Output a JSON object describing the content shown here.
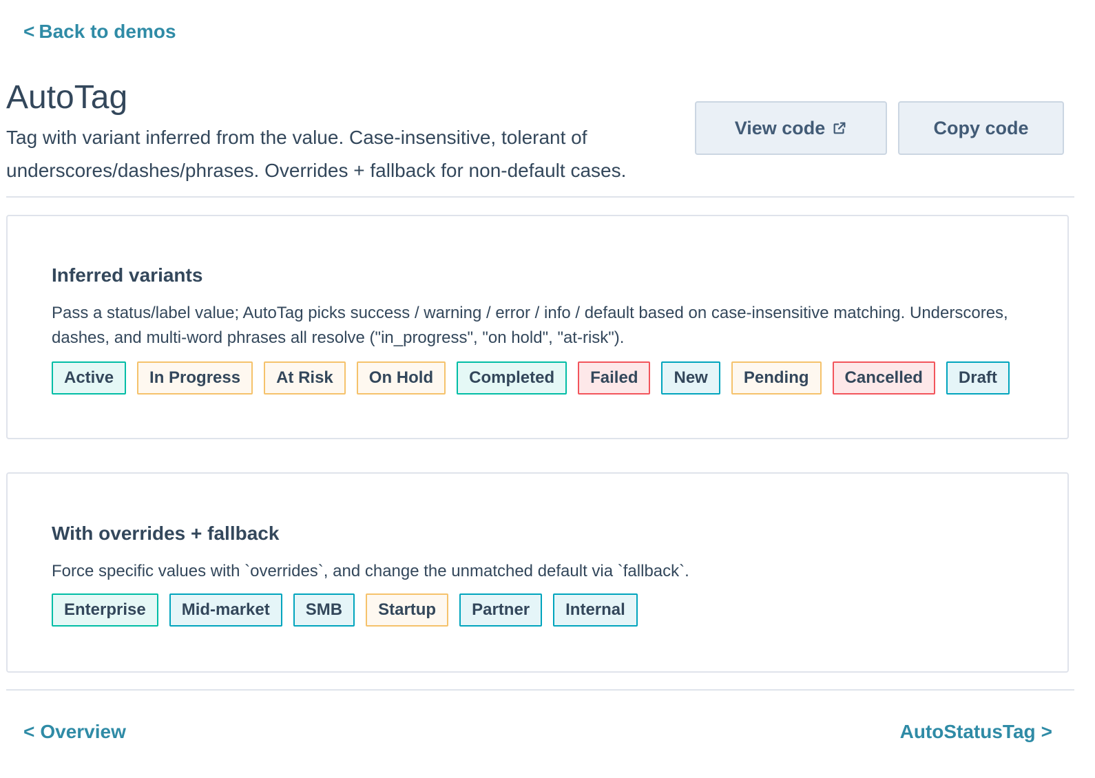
{
  "back": {
    "label": "Back to demos",
    "chevron": "<"
  },
  "header": {
    "title": "AutoTag",
    "description": "Tag with variant inferred from the value. Case-insensitive, tolerant of underscores/dashes/phrases. Overrides + fallback for non-default cases."
  },
  "buttons": {
    "view_code": "View code",
    "view_code_icon": "external-link-icon",
    "copy_code": "Copy code"
  },
  "sections": [
    {
      "title": "Inferred variants",
      "description": "Pass a status/label value; AutoTag picks success / warning / error / info / default based on case-insensitive matching. Underscores, dashes, and multi-word phrases all resolve (\"in_progress\", \"on hold\", \"at-risk\").",
      "tags": [
        {
          "label": "Active",
          "variant": "success"
        },
        {
          "label": "In Progress",
          "variant": "warning"
        },
        {
          "label": "At Risk",
          "variant": "warning"
        },
        {
          "label": "On Hold",
          "variant": "warning"
        },
        {
          "label": "Completed",
          "variant": "success"
        },
        {
          "label": "Failed",
          "variant": "error"
        },
        {
          "label": "New",
          "variant": "info"
        },
        {
          "label": "Pending",
          "variant": "warning"
        },
        {
          "label": "Cancelled",
          "variant": "error"
        },
        {
          "label": "Draft",
          "variant": "info"
        }
      ]
    },
    {
      "title": "With overrides + fallback",
      "description": "Force specific values with `overrides`, and change the unmatched default via `fallback`.",
      "tags": [
        {
          "label": "Enterprise",
          "variant": "success"
        },
        {
          "label": "Mid-market",
          "variant": "info"
        },
        {
          "label": "SMB",
          "variant": "info"
        },
        {
          "label": "Startup",
          "variant": "warning"
        },
        {
          "label": "Partner",
          "variant": "info"
        },
        {
          "label": "Internal",
          "variant": "info"
        }
      ]
    }
  ],
  "footer_nav": {
    "prev": "Overview",
    "prev_chevron": "<",
    "next": "AutoStatusTag",
    "next_chevron": ">"
  },
  "colors": {
    "link": "#2f8ba6",
    "text": "#33475b",
    "success_border": "#00bda5",
    "warning_border": "#f5c26b",
    "error_border": "#f2545b",
    "info_border": "#00a4bd"
  }
}
